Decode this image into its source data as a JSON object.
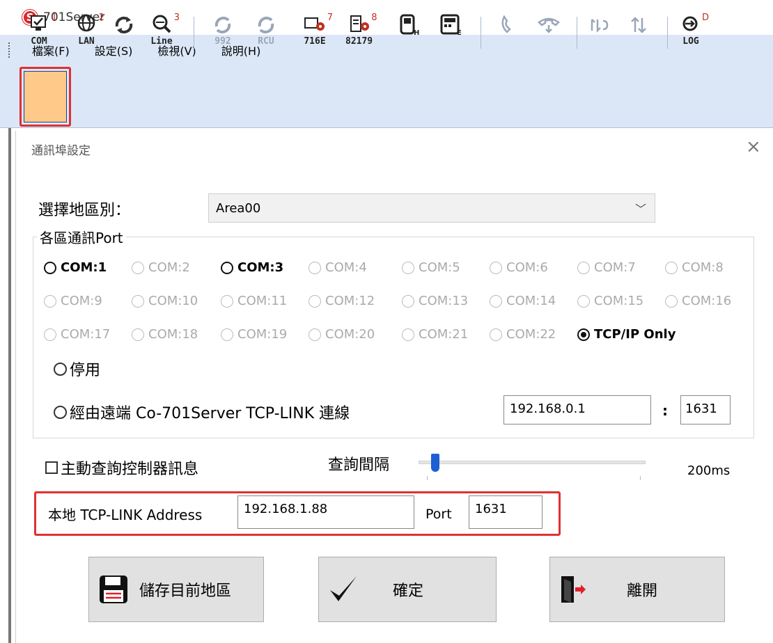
{
  "window": {
    "title": "701Server",
    "logo_letter": "S"
  },
  "menu": [
    "檔案(F)",
    "設定(S)",
    "檢視(V)",
    "說明(H)"
  ],
  "toolbar": {
    "com": {
      "label": "COM",
      "num": "1"
    },
    "lan": {
      "label": "LAN",
      "num": "2"
    },
    "line": {
      "label": "Line",
      "num": "3"
    },
    "b992": {
      "label": "992"
    },
    "rcu": {
      "label": "RCU"
    },
    "b716e": {
      "label": "716E",
      "num": "7"
    },
    "b82179": {
      "label": "82179",
      "num": "8"
    },
    "log": {
      "label": "LOG",
      "num": "D"
    }
  },
  "dialog": {
    "title": "通訊埠設定",
    "close": "×",
    "region_label": "選擇地區別：",
    "region_value": "Area00",
    "group_label": "各區通訊Port",
    "com_ports": [
      {
        "label": "COM:1",
        "enabled": true,
        "selected": false
      },
      {
        "label": "COM:2",
        "enabled": false,
        "selected": false
      },
      {
        "label": "COM:3",
        "enabled": true,
        "selected": false
      },
      {
        "label": "COM:4",
        "enabled": false,
        "selected": false
      },
      {
        "label": "COM:5",
        "enabled": false,
        "selected": false
      },
      {
        "label": "COM:6",
        "enabled": false,
        "selected": false
      },
      {
        "label": "COM:7",
        "enabled": false,
        "selected": false
      },
      {
        "label": "COM:8",
        "enabled": false,
        "selected": false
      },
      {
        "label": "COM:9",
        "enabled": false,
        "selected": false
      },
      {
        "label": "COM:10",
        "enabled": false,
        "selected": false
      },
      {
        "label": "COM:11",
        "enabled": false,
        "selected": false
      },
      {
        "label": "COM:12",
        "enabled": false,
        "selected": false
      },
      {
        "label": "COM:13",
        "enabled": false,
        "selected": false
      },
      {
        "label": "COM:14",
        "enabled": false,
        "selected": false
      },
      {
        "label": "COM:15",
        "enabled": false,
        "selected": false
      },
      {
        "label": "COM:16",
        "enabled": false,
        "selected": false
      },
      {
        "label": "COM:17",
        "enabled": false,
        "selected": false
      },
      {
        "label": "COM:18",
        "enabled": false,
        "selected": false
      },
      {
        "label": "COM:19",
        "enabled": false,
        "selected": false
      },
      {
        "label": "COM:20",
        "enabled": false,
        "selected": false
      },
      {
        "label": "COM:21",
        "enabled": false,
        "selected": false
      },
      {
        "label": "COM:22",
        "enabled": false,
        "selected": false
      },
      {
        "label": "TCP/IP Only",
        "enabled": true,
        "selected": true
      }
    ],
    "disable_label": "停用",
    "remote_label": "經由遠端 Co-701Server  TCP-LINK 連線",
    "remote_ip": "192.168.0.1",
    "remote_colon": ":",
    "remote_port": "1631",
    "poll_label": "主動查詢控制器訊息",
    "interval_label": "查詢間隔",
    "interval_value": "200ms",
    "local_label": "本地 TCP-LINK Address",
    "local_address": "192.168.1.88",
    "local_port_label": "Port",
    "local_port": "1631",
    "save_button": "儲存目前地區",
    "ok_button": "確定",
    "exit_button": "離開"
  }
}
